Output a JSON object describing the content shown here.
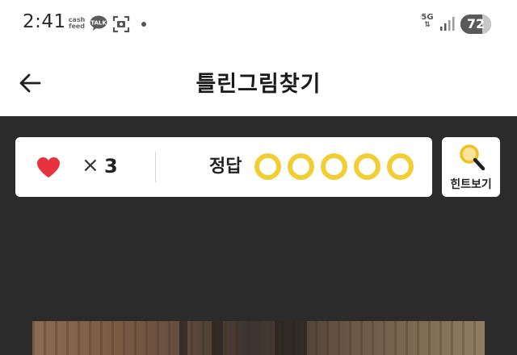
{
  "status_bar": {
    "time": "2:41",
    "cashfeed_label_top": "cash",
    "cashfeed_label_bottom": "feed",
    "talk_label": "TALK",
    "network_label": "5G",
    "battery_level": "72"
  },
  "app_bar": {
    "title": "틀린그림찾기",
    "back_icon": "arrow-left-icon"
  },
  "game": {
    "lives_icon": "heart-icon",
    "lives_multiplier": "×",
    "lives_count": "3",
    "answer_label": "정답",
    "answers_total": 5,
    "answers_found": 0,
    "hint_label": "힌트보기",
    "hint_icon": "magnifier-icon"
  },
  "colors": {
    "heart": "#e8333f",
    "answer_circle": "#f2ce34",
    "game_background": "#2b2b2b"
  }
}
